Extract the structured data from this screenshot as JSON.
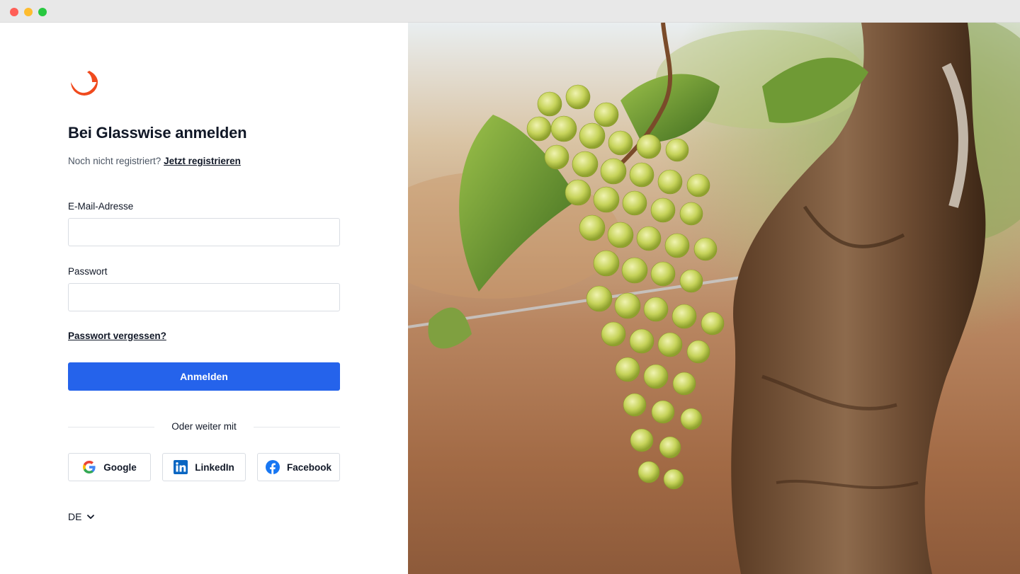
{
  "window": {
    "controls": [
      "close",
      "minimize",
      "maximize"
    ]
  },
  "brand": {
    "logo_icon": "glasswise-arc-logo",
    "accent_color": "#f04a1d"
  },
  "login": {
    "title": "Bei Glasswise anmelden",
    "subtitle_prefix": "Noch nicht registriert?",
    "register_link": "Jetzt registrieren",
    "email_label": "E-Mail-Adresse",
    "email_value": "",
    "email_placeholder": "",
    "password_label": "Passwort",
    "password_value": "",
    "password_placeholder": "",
    "forgot_link": "Passwort vergessen?",
    "submit_label": "Anmelden",
    "primary_color": "#2563eb",
    "divider_text": "Oder weiter mit"
  },
  "social": [
    {
      "label": "Google",
      "icon": "google-icon"
    },
    {
      "label": "LinkedIn",
      "icon": "linkedin-icon"
    },
    {
      "label": "Facebook",
      "icon": "facebook-icon"
    }
  ],
  "language": {
    "current": "DE",
    "icon": "chevron-down-icon"
  },
  "hero_image": {
    "subject": "vineyard-grape-photo"
  }
}
